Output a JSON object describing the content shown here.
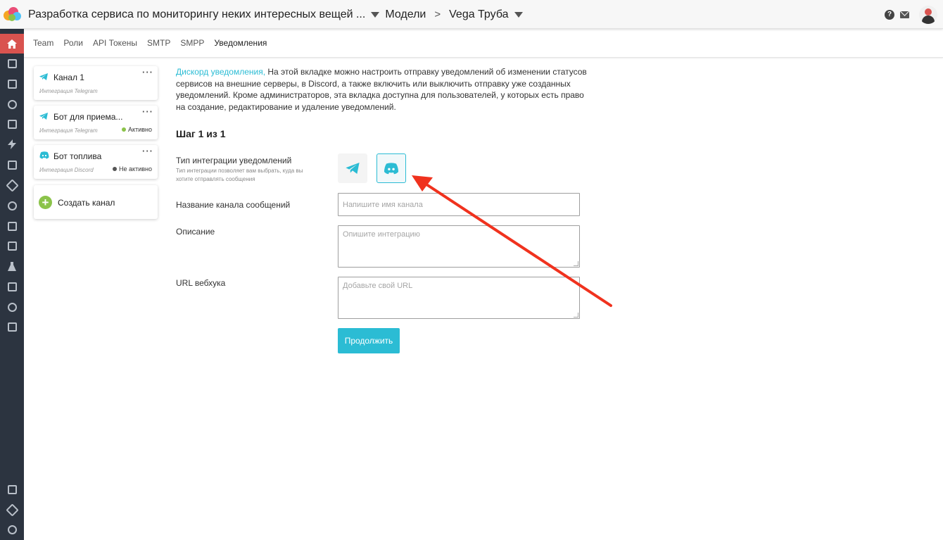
{
  "header": {
    "project": "Разработка сервиса по мониторингу неких интересных вещей ...",
    "section": "Модели",
    "model": "Vega Труба"
  },
  "subnav": {
    "tabs": [
      "Team",
      "Роли",
      "API Токены",
      "SMTP",
      "SMPP",
      "Уведомления"
    ],
    "active": "Уведомления"
  },
  "channels": [
    {
      "title": "Канал 1",
      "integration": "Интеграция Telegram",
      "status": "",
      "icon": "telegram-icon"
    },
    {
      "title": "Бот для приема...",
      "integration": "Интеграция Telegram",
      "status": "Активно",
      "status_color": "#8bc34a",
      "icon": "telegram-icon"
    },
    {
      "title": "Бот топлива",
      "integration": "Интеграция Discord",
      "status": "Не активно",
      "status_color": "#555555",
      "icon": "discord-icon"
    }
  ],
  "create_channel": "Создать канал",
  "intro": {
    "link": "Дискорд уведомления,",
    "text": " На этой вкладке можно настроить отправку уведомлений об изменении статусов сервисов на внешние серверы, в Discord, а также включить или выключить отправку уже созданных уведомлений. Кроме администраторов, эта вкладка доступна для пользователей, у которых есть право на создание, редактирование и удаление уведомлений."
  },
  "step": "Шаг 1 из 1",
  "form": {
    "type_label": "Тип интеграции уведомлений",
    "type_hint": "Тип интеграции позволяет вам выбрать, куда вы хотите отправлять сообщения",
    "selected_type": "discord",
    "name_label": "Название канала сообщений",
    "name_placeholder": "Напишите имя канала",
    "desc_label": "Описание",
    "desc_placeholder": "Опишите интеграцию",
    "url_label": "URL вебхука",
    "url_placeholder": "Добавьте свой URL",
    "submit": "Продолжить"
  },
  "colors": {
    "accent": "#2bbcd4",
    "sidebar": "#2c3440",
    "active_nav": "#d9534f",
    "annotation_arrow": "#f0321e"
  }
}
